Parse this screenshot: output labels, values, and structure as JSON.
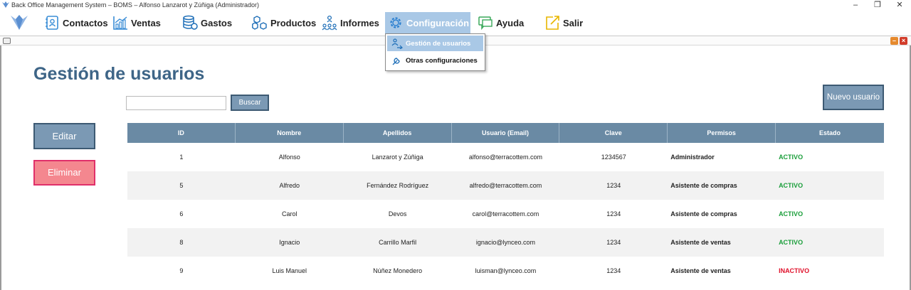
{
  "window": {
    "title": "Back Office Management System – BOMS – Alfonso Lanzarot y Zúñiga (Administrador)",
    "controls": {
      "minimize": "–",
      "restore": "❐",
      "close": "✕"
    }
  },
  "menu": {
    "items": [
      {
        "label": "Contactos",
        "icon": "contacts-icon"
      },
      {
        "label": "Ventas",
        "icon": "chart-icon"
      },
      {
        "label": "Gastos",
        "icon": "coins-icon"
      },
      {
        "label": "Productos",
        "icon": "boxes-icon"
      },
      {
        "label": "Informes",
        "icon": "people-icon"
      },
      {
        "label": "Configuración",
        "icon": "gear-icon",
        "active": true
      },
      {
        "label": "Ayuda",
        "icon": "chat-icon"
      },
      {
        "label": "Salir",
        "icon": "exit-icon"
      }
    ],
    "dropdown": [
      {
        "label": "Gestión de usuarios",
        "icon": "users-gear-icon",
        "highlighted": true
      },
      {
        "label": "Otras configuraciones",
        "icon": "wrench-icon"
      }
    ]
  },
  "page": {
    "title": "Gestión de usuarios",
    "search_value": "",
    "search_button": "Buscar",
    "new_button": "Nuevo usuario",
    "edit_button": "Editar",
    "delete_button": "Eliminar"
  },
  "colors": {
    "accent": "#6a8aa4",
    "title": "#3e6587",
    "active": "#1a9e3a",
    "inactive": "#e0102a",
    "delete": "#f4878f"
  },
  "table": {
    "headers": [
      "ID",
      "Nombre",
      "Apellidos",
      "Usuario (Email)",
      "Clave",
      "Permisos",
      "Estado"
    ],
    "rows": [
      {
        "id": "1",
        "nombre": "Alfonso",
        "apellidos": "Lanzarot y Zúñiga",
        "email": "alfonso@terracottem.com",
        "clave": "1234567",
        "permisos": "Administrador",
        "estado": "ACTIVO"
      },
      {
        "id": "5",
        "nombre": "Alfredo",
        "apellidos": "Fernández Rodríguez",
        "email": "alfredo@terracottem.com",
        "clave": "1234",
        "permisos": "Asistente de compras",
        "estado": "ACTIVO"
      },
      {
        "id": "6",
        "nombre": "Carol",
        "apellidos": "Devos",
        "email": "carol@terracottem.com",
        "clave": "1234",
        "permisos": "Asistente de compras",
        "estado": "ACTIVO"
      },
      {
        "id": "8",
        "nombre": "Ignacio",
        "apellidos": "Carrillo Marfil",
        "email": "ignacio@lynceo.com",
        "clave": "1234",
        "permisos": "Asistente de ventas",
        "estado": "ACTIVO"
      },
      {
        "id": "9",
        "nombre": "Luis Manuel",
        "apellidos": "Núñez Monedero",
        "email": "luisman@lynceo.com",
        "clave": "1234",
        "permisos": "Asistente de ventas",
        "estado": "INACTIVO"
      }
    ]
  }
}
